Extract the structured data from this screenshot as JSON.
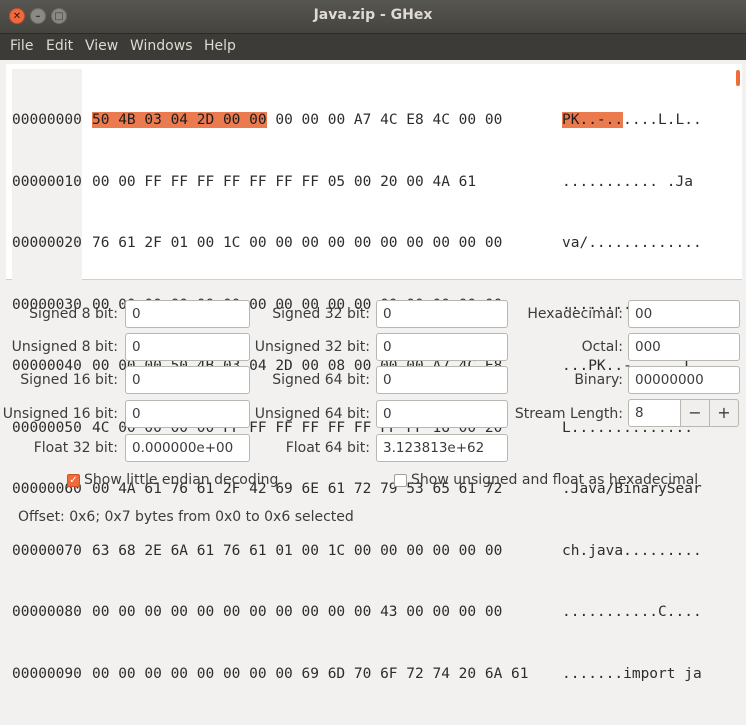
{
  "window": {
    "title": "Java.zip - GHex"
  },
  "menu": [
    "File",
    "Edit",
    "View",
    "Windows",
    "Help"
  ],
  "hex_view": {
    "rows": [
      {
        "offset": "00000000",
        "hex_selected": "50 4B 03 04 2D 00 00",
        "hex_rest": " 00 00 00 A7 4C E8 4C 00 00",
        "ascii_selected": "PK..-..",
        "ascii_rest": "....L.L.."
      },
      {
        "offset": "00000010",
        "hex_selected": "",
        "hex_rest": "00 00 FF FF FF FF FF FF FF 05 00 20 00 4A 61",
        "ascii_selected": "",
        "ascii_rest": "........... .Ja"
      },
      {
        "offset": "00000020",
        "hex_selected": "",
        "hex_rest": "76 61 2F 01 00 1C 00 00 00 00 00 00 00 00 00 00",
        "ascii_selected": "",
        "ascii_rest": "va/............."
      },
      {
        "offset": "00000030",
        "hex_selected": "",
        "hex_rest": "00 00 00 00 00 00 00 00 00 00 00 00 00 00 00 00",
        "ascii_selected": "",
        "ascii_rest": "................"
      },
      {
        "offset": "00000040",
        "hex_selected": "",
        "hex_rest": "00 00 00 50 4B 03 04 2D 00 08 00 00 00 A7 4C E8",
        "ascii_selected": "",
        "ascii_rest": "...PK..-......L."
      },
      {
        "offset": "00000050",
        "hex_selected": "",
        "hex_rest": "4C 00 00 00 00 FF FF FF FF FF FF FF FF 16 00 20",
        "ascii_selected": "",
        "ascii_rest": "L.............. "
      },
      {
        "offset": "00000060",
        "hex_selected": "",
        "hex_rest": "00 4A 61 76 61 2F 42 69 6E 61 72 79 53 65 61 72",
        "ascii_selected": "",
        "ascii_rest": ".Java/BinarySear"
      },
      {
        "offset": "00000070",
        "hex_selected": "",
        "hex_rest": "63 68 2E 6A 61 76 61 01 00 1C 00 00 00 00 00 00",
        "ascii_selected": "",
        "ascii_rest": "ch.java........."
      },
      {
        "offset": "00000080",
        "hex_selected": "",
        "hex_rest": "00 00 00 00 00 00 00 00 00 00 00 43 00 00 00 00",
        "ascii_selected": "",
        "ascii_rest": "...........C...."
      },
      {
        "offset": "00000090",
        "hex_selected": "",
        "hex_rest": "00 00 00 00 00 00 00 00 69 6D 70 6F 72 74 20 6A 61",
        "ascii_selected": "",
        "ascii_rest": ".......import ja"
      }
    ]
  },
  "decoder": {
    "signed_8": {
      "label": "Signed 8 bit:",
      "value": "0"
    },
    "unsigned_8": {
      "label": "Unsigned 8 bit:",
      "value": "0"
    },
    "signed_16": {
      "label": "Signed 16 bit:",
      "value": "0"
    },
    "unsigned_16": {
      "label": "Unsigned 16 bit:",
      "value": "0"
    },
    "float_32": {
      "label": "Float 32 bit:",
      "value": "0.000000e+00"
    },
    "signed_32": {
      "label": "Signed 32 bit:",
      "value": "0"
    },
    "unsigned_32": {
      "label": "Unsigned 32 bit:",
      "value": "0"
    },
    "signed_64": {
      "label": "Signed 64 bit:",
      "value": "0"
    },
    "unsigned_64": {
      "label": "Unsigned 64 bit:",
      "value": "0"
    },
    "float_64": {
      "label": "Float 64 bit:",
      "value": "3.123813e+62"
    },
    "hexadecimal": {
      "label": "Hexadecimal:",
      "value": "00"
    },
    "octal": {
      "label": "Octal:",
      "value": "000"
    },
    "binary": {
      "label": "Binary:",
      "value": "00000000"
    },
    "stream_length": {
      "label": "Stream Length:",
      "value": "8",
      "minus": "−",
      "plus": "+"
    }
  },
  "options": {
    "little_endian": {
      "label": "Show little endian decoding",
      "checked": true
    },
    "unsigned_hex": {
      "label": "Show unsigned and float as hexadecimal",
      "checked": false
    }
  },
  "status": "Offset: 0x6; 0x7 bytes from 0x0 to 0x6 selected"
}
